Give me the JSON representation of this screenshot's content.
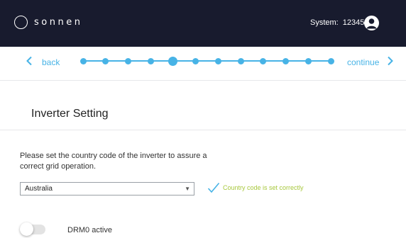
{
  "header": {
    "logo_text": "sonnen",
    "system_label": "System:",
    "system_number": "12345"
  },
  "stepper": {
    "back_label": "back",
    "continue_label": "continue",
    "total_steps": 12,
    "current_step": 5
  },
  "page": {
    "title": "Inverter Setting",
    "description": "Please set the country code of the inverter to assure a correct grid operation."
  },
  "country_select": {
    "value": "Australia",
    "status_text": "Country code is set correctly"
  },
  "drm0_toggle": {
    "label": "DRM0 active",
    "on": false
  },
  "colors": {
    "header_bg": "#181b2e",
    "accent": "#47b3e6",
    "success": "#a7c83c"
  }
}
